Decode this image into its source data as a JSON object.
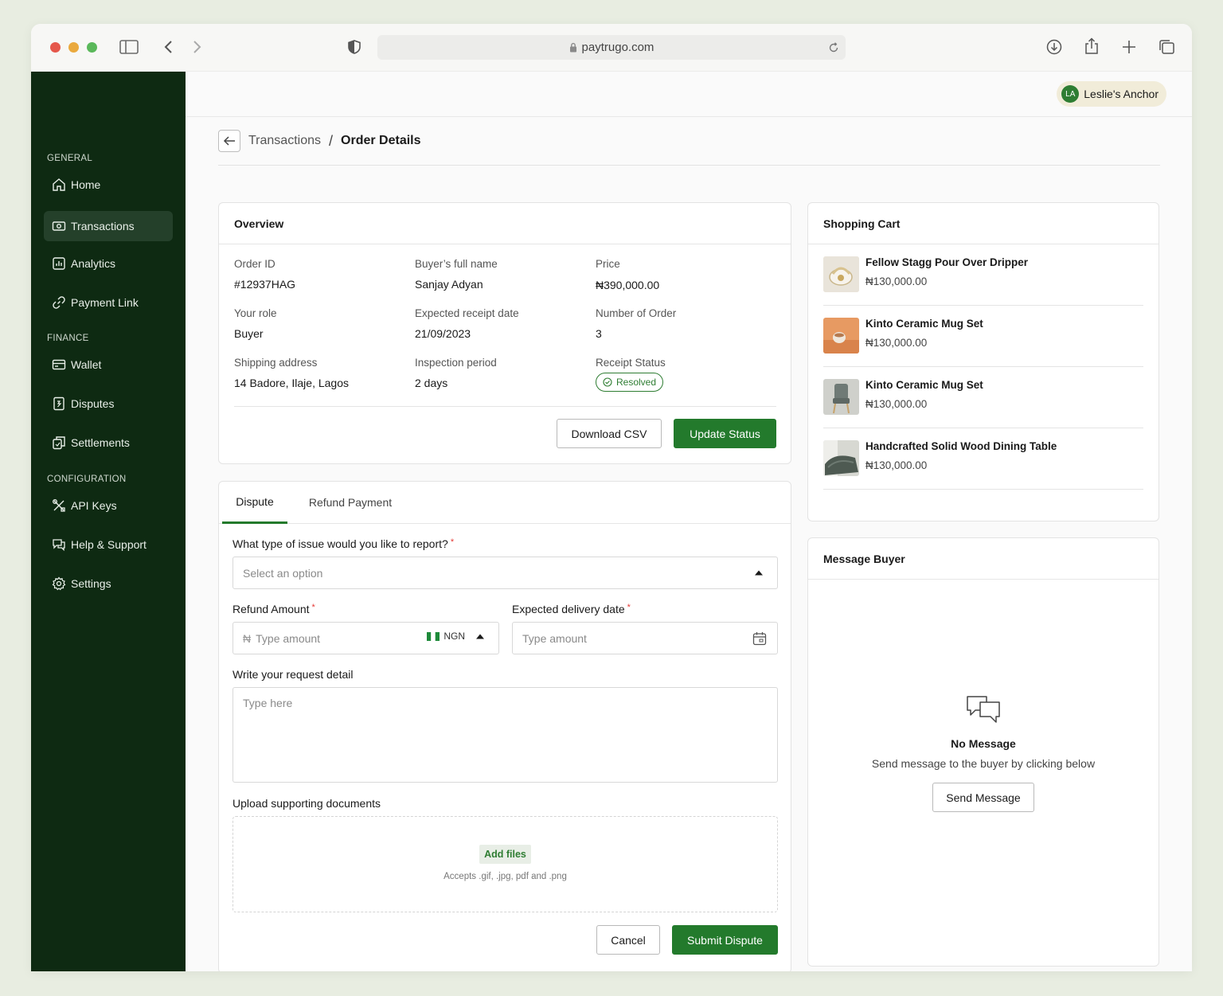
{
  "browser": {
    "url": "paytrugo.com"
  },
  "sidebar": {
    "sections": [
      {
        "label": "GENERAL"
      },
      {
        "label": "FINANCE"
      },
      {
        "label": "CONFIGURATION"
      }
    ],
    "items": [
      {
        "label": "Home",
        "icon": "home-icon"
      },
      {
        "label": "Transactions",
        "icon": "transactions-icon",
        "active": true
      },
      {
        "label": "Analytics",
        "icon": "analytics-icon"
      },
      {
        "label": "Payment Link",
        "icon": "link-icon"
      },
      {
        "label": "Wallet",
        "icon": "wallet-icon"
      },
      {
        "label": "Disputes",
        "icon": "disputes-icon"
      },
      {
        "label": "Settlements",
        "icon": "settlements-icon"
      },
      {
        "label": "API Keys",
        "icon": "api-keys-icon"
      },
      {
        "label": "Help & Support",
        "icon": "help-icon"
      },
      {
        "label": "Settings",
        "icon": "settings-icon"
      }
    ]
  },
  "user": {
    "initials": "LA",
    "name": "Leslie's Anchor"
  },
  "breadcrumb": {
    "parent": "Transactions",
    "separator": "/",
    "current": "Order Details"
  },
  "overview": {
    "title": "Overview",
    "fields": [
      {
        "label": "Order ID",
        "value": "#12937HAG"
      },
      {
        "label": "Buyer’s full name",
        "value": "Sanjay Adyan"
      },
      {
        "label": "Price",
        "value": "₦390,000.00"
      },
      {
        "label": "Your role",
        "value": "Buyer"
      },
      {
        "label": "Expected receipt date",
        "value": "21/09/2023"
      },
      {
        "label": "Number of Order",
        "value": "3"
      },
      {
        "label": "Shipping address",
        "value": "14 Badore, Ilaje, Lagos"
      },
      {
        "label": "Inspection period",
        "value": "2 days"
      },
      {
        "label": "Receipt Status",
        "value": "Resolved"
      }
    ],
    "download_label": "Download CSV",
    "update_label": "Update Status"
  },
  "dispute": {
    "tabs": [
      {
        "label": "Dispute",
        "active": true
      },
      {
        "label": "Refund Payment",
        "active": false
      }
    ],
    "issue_label": "What type of issue would you like to report?",
    "issue_placeholder": "Select an option",
    "refund_label": "Refund Amount",
    "refund_placeholder": "Type amount",
    "currency": "NGN",
    "currency_symbol": "₦",
    "delivery_label": "Expected delivery date",
    "delivery_placeholder": "Type amount",
    "detail_label": "Write your request detail",
    "detail_placeholder": "Type here",
    "upload_label": "Upload supporting documents",
    "add_files": "Add files",
    "accepts": "Accepts .gif, .jpg, pdf and .png",
    "required_mark": "*",
    "cancel_label": "Cancel",
    "submit_label": "Submit Dispute"
  },
  "cart": {
    "title": "Shopping Cart",
    "items": [
      {
        "name": "Fellow Stagg Pour Over Dripper",
        "price": "₦130,000.00"
      },
      {
        "name": "Kinto Ceramic Mug Set",
        "price": "₦130,000.00"
      },
      {
        "name": "Kinto Ceramic Mug Set",
        "price": "₦130,000.00"
      },
      {
        "name": "Handcrafted Solid Wood Dining Table",
        "price": "₦130,000.00"
      }
    ]
  },
  "message": {
    "title": "Message Buyer",
    "empty_title": "No Message",
    "empty_sub": "Send message to the buyer by clicking below",
    "send_label": "Send Message"
  },
  "colors": {
    "sidebar_bg": "#0e2a12",
    "accent_green": "#237a2c",
    "page_bg": "#e8ede1"
  }
}
